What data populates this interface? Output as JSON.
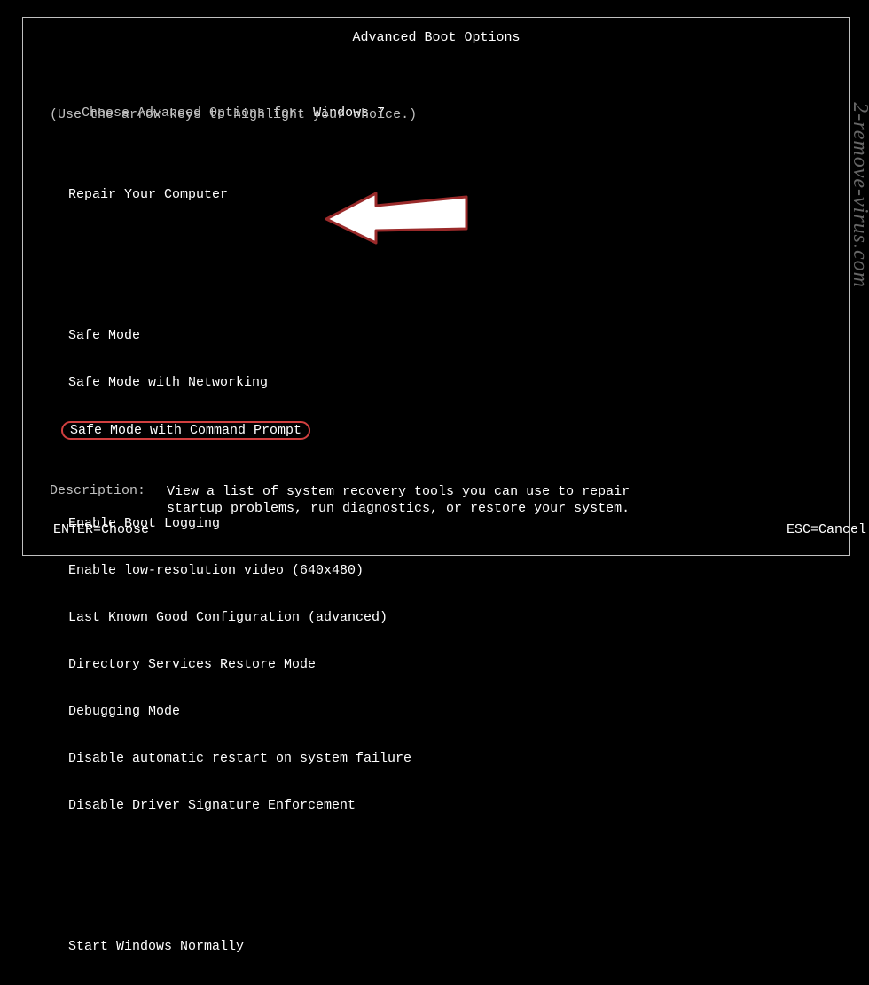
{
  "title": "Advanced Boot Options",
  "choose_prefix": "Choose Advanced Options for: ",
  "os_name": "Windows 7",
  "hint": "(Use the arrow keys to highlight your choice.)",
  "menu": {
    "repair": "Repair Your Computer",
    "safe_mode": "Safe Mode",
    "safe_mode_net": "Safe Mode with Networking",
    "safe_mode_cmd": "Safe Mode with Command Prompt",
    "boot_log": "Enable Boot Logging",
    "low_res": "Enable low-resolution video (640x480)",
    "lkgc": "Last Known Good Configuration (advanced)",
    "dsrm": "Directory Services Restore Mode",
    "debug": "Debugging Mode",
    "no_auto_restart": "Disable automatic restart on system failure",
    "no_sig": "Disable Driver Signature Enforcement",
    "normal": "Start Windows Normally"
  },
  "description_label": "Description:",
  "description_text": "View a list of system recovery tools you can use to repair\nstartup problems, run diagnostics, or restore your system.",
  "footer_left": "ENTER=Choose",
  "footer_right": "ESC=Cancel",
  "watermark": "2-remove-virus.com",
  "highlight_color": "#d24040"
}
